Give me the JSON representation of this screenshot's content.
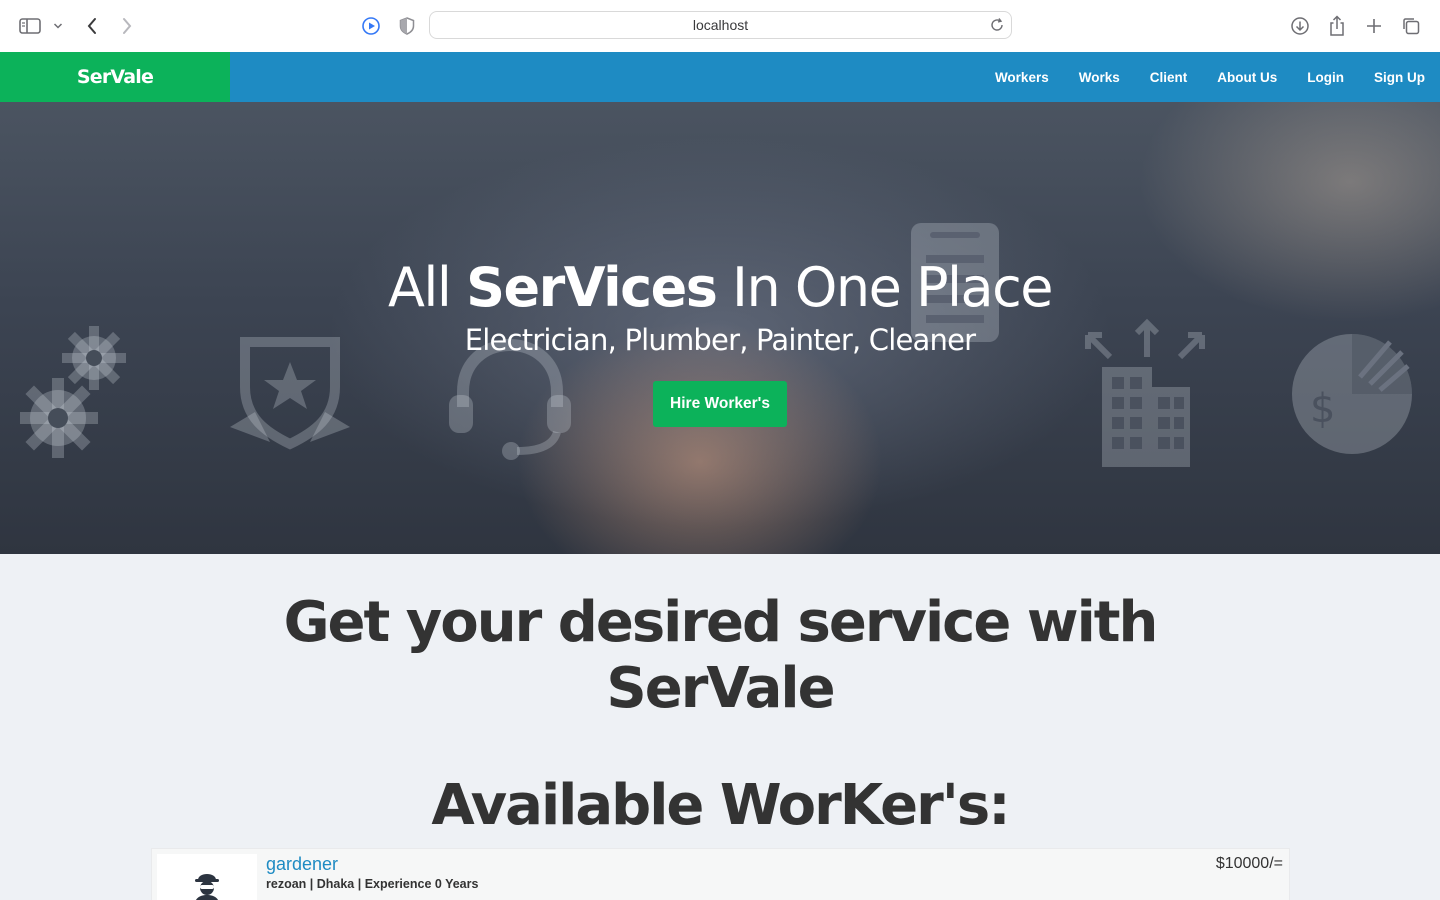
{
  "browser": {
    "url": "localhost"
  },
  "navbar": {
    "brand": "SerVale",
    "links": [
      "Workers",
      "Works",
      "Client",
      "About Us",
      "Login",
      "Sign Up"
    ],
    "colors": {
      "bar": "#1e8bc3",
      "brand_bg": "#0cb25a"
    }
  },
  "hero": {
    "title_pre": "All ",
    "title_bold": "SerVices",
    "title_post": " In One Place",
    "subtitle": "Electrician, Plumber, Painter, Cleaner",
    "button_label": "Hire Worker's"
  },
  "main": {
    "tagline": "Get your desired service with",
    "tagline_brand": "SerVale",
    "workers_heading": "Available WorKer's:"
  },
  "workers": [
    {
      "title": "gardener",
      "meta": "rezoan | Dhaka | Experience 0 Years",
      "price": "$10000/="
    }
  ]
}
